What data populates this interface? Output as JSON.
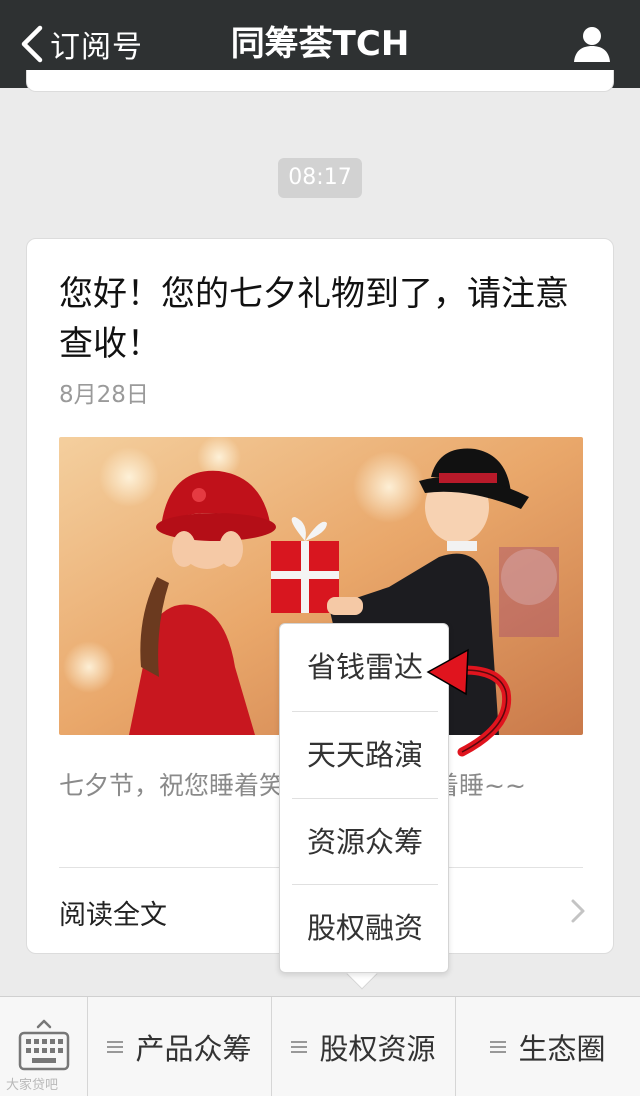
{
  "navbar": {
    "back_label": "订阅号",
    "title": "同筹荟TCH"
  },
  "timestamp": "08:17",
  "article": {
    "title": "您好！您的七夕礼物到了，请注意查收！",
    "date": "8月28日",
    "summary": "七夕节，祝您睡着笑，醒着笑，笑着睡~~",
    "read_more": "阅读全文"
  },
  "popup_menu": {
    "items": [
      "省钱雷达",
      "天天路演",
      "资源众筹",
      "股权融资"
    ]
  },
  "bottom_menu": {
    "tabs": [
      {
        "label": "产品众筹"
      },
      {
        "label": "股权资源"
      },
      {
        "label": "生态圈"
      }
    ]
  },
  "watermark": "大家贷吧",
  "colors": {
    "navbar_bg": "#2e3132",
    "page_bg": "#ebebeb",
    "highlight_arrow": "#e0141e"
  }
}
